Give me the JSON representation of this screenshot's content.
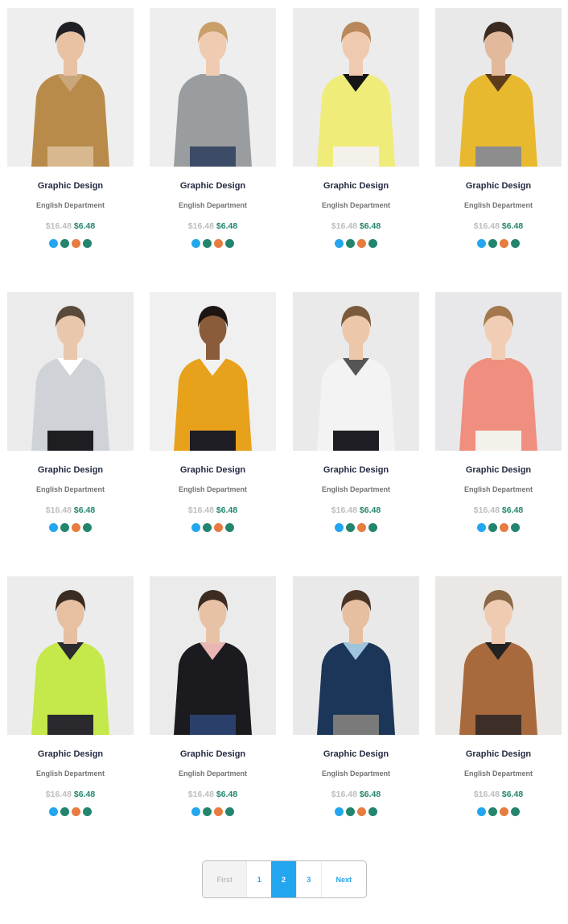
{
  "colors": {
    "blue": "#23a6f0",
    "teal": "#23856d",
    "orange": "#e77c40",
    "darkgreen": "#23856d"
  },
  "products": [
    {
      "title": "Graphic Design",
      "dept": "English Department",
      "old_price": "$16.48",
      "new_price": "$6.48",
      "image": "man-tan-hooded-jacket-cap"
    },
    {
      "title": "Graphic Design",
      "dept": "English Department",
      "old_price": "$16.48",
      "new_price": "$6.48",
      "image": "woman-grey-sweater"
    },
    {
      "title": "Graphic Design",
      "dept": "English Department",
      "old_price": "$16.48",
      "new_price": "$6.48",
      "image": "woman-yellow-cardigan-black-top"
    },
    {
      "title": "Graphic Design",
      "dept": "English Department",
      "old_price": "$16.48",
      "new_price": "$6.48",
      "image": "man-yellow-print-shirt"
    },
    {
      "title": "Graphic Design",
      "dept": "English Department",
      "old_price": "$16.48",
      "new_price": "$6.48",
      "image": "man-grey-parka"
    },
    {
      "title": "Graphic Design",
      "dept": "English Department",
      "old_price": "$16.48",
      "new_price": "$6.48",
      "image": "man-orange-puffer-vest"
    },
    {
      "title": "Graphic Design",
      "dept": "English Department",
      "old_price": "$16.48",
      "new_price": "$6.48",
      "image": "man-white-print-shirt"
    },
    {
      "title": "Graphic Design",
      "dept": "English Department",
      "old_price": "$16.48",
      "new_price": "$6.48",
      "image": "woman-pink-top"
    },
    {
      "title": "Graphic Design",
      "dept": "English Department",
      "old_price": "$16.48",
      "new_price": "$6.48",
      "image": "man-lime-windbreaker"
    },
    {
      "title": "Graphic Design",
      "dept": "English Department",
      "old_price": "$16.48",
      "new_price": "$6.48",
      "image": "man-black-bomber-pink-hoodie"
    },
    {
      "title": "Graphic Design",
      "dept": "English Department",
      "old_price": "$16.48",
      "new_price": "$6.48",
      "image": "man-navy-print-shirt"
    },
    {
      "title": "Graphic Design",
      "dept": "English Department",
      "old_price": "$16.48",
      "new_price": "$6.48",
      "image": "woman-brown-leather-jacket"
    }
  ],
  "swatch_colors": [
    "#23a6f0",
    "#23856d",
    "#e77c40",
    "#23856d"
  ],
  "pagination": {
    "first": "First",
    "pages": [
      "1",
      "2",
      "3"
    ],
    "active": "2",
    "next": "Next"
  }
}
